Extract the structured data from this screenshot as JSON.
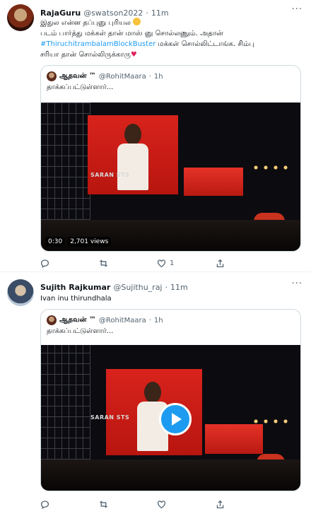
{
  "tweets": [
    {
      "name": "RajaGuru",
      "handle": "@swatson2022",
      "dot": "·",
      "time": "11m",
      "more": "···",
      "text_line1": "இதுல என்ன தப்புனு புரியல",
      "text_line2": "படம் பார்த்து மக்கள் தான் மாஸ் னு சொல்லணும். அதான்",
      "hashtag": "#ThiruchitrambalamBlockBuster",
      "text_line3_rest": " மக்கள் சொல்லிட்டாங்க. சிம்பு",
      "text_line4": "சரியா தான் சொல்லிருக்காரு",
      "heart": "♥",
      "quote": {
        "name": "ஆதவன் ™",
        "handle": "@RohitMaara",
        "dot": "·",
        "time": "1h",
        "text": "தாக்கப்பட்டுள்ளார்...",
        "watermark": "SARAN STS",
        "duration": "0:30",
        "views": "2,701 views"
      },
      "actions": {
        "reply": "",
        "retweet": "",
        "like": "1",
        "share": ""
      }
    },
    {
      "name": "Sujith Rajkumar",
      "handle": "@Sujithu_raj",
      "dot": "·",
      "time": "11m",
      "more": "···",
      "text": "Ivan inu thirundhala",
      "quote": {
        "name": "ஆதவன் ™",
        "handle": "@RohitMaara",
        "dot": "·",
        "time": "1h",
        "text": "தாக்கப்பட்டுள்ளார்...",
        "watermark": "SARAN STS"
      },
      "actions": {
        "reply": "",
        "retweet": "",
        "like": "",
        "share": ""
      }
    }
  ],
  "colors": {
    "link": "#1d9bf0",
    "muted": "#536471",
    "border": "#cfd9de",
    "heart": "#e0245e"
  },
  "icons": [
    "reply-icon",
    "retweet-icon",
    "like-icon",
    "share-icon",
    "more-icon",
    "play-icon"
  ]
}
